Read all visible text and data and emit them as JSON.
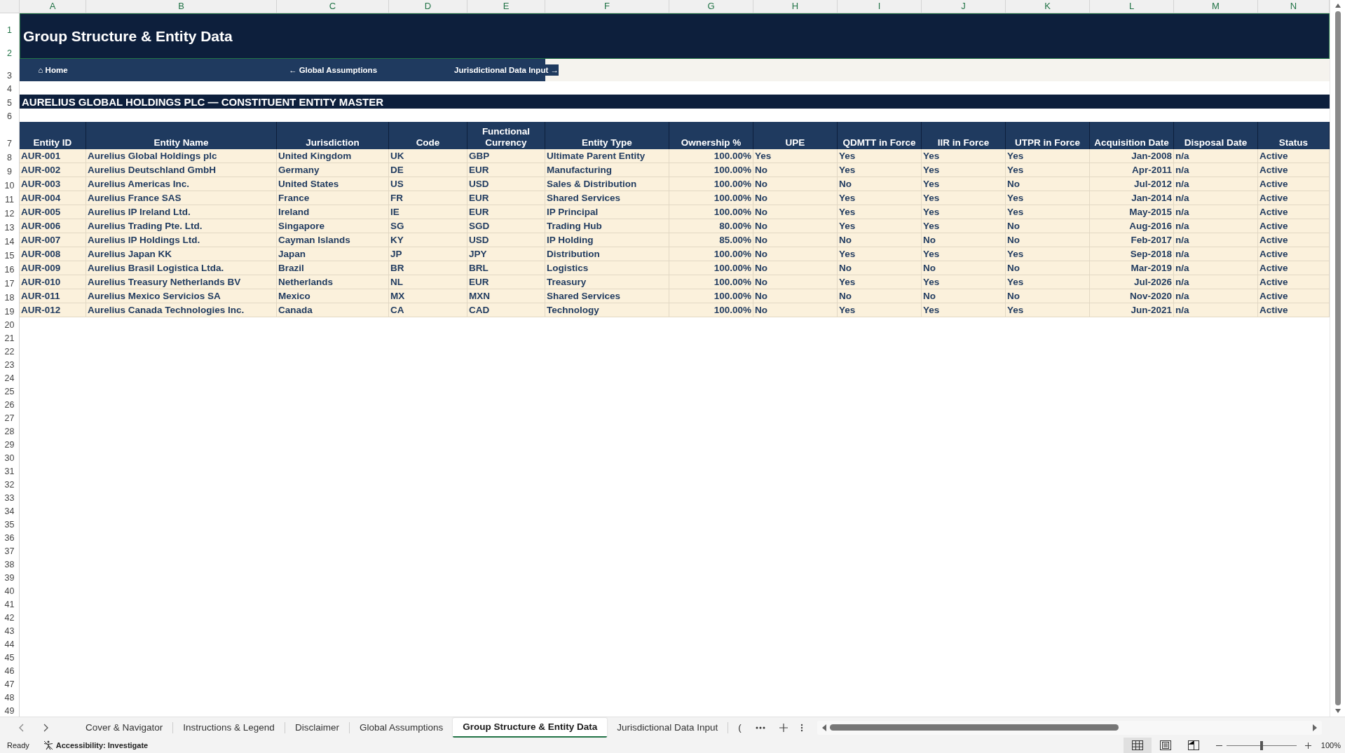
{
  "title": "Group Structure & Entity Data",
  "column_letters": [
    "A",
    "B",
    "C",
    "D",
    "E",
    "F",
    "G",
    "H",
    "I",
    "J",
    "K",
    "L",
    "M",
    "N"
  ],
  "row_numbers": [
    "1",
    "2",
    "3",
    "4",
    "5",
    "6",
    "7",
    "8",
    "9",
    "10",
    "11",
    "12",
    "13",
    "14",
    "15",
    "16",
    "17",
    "18",
    "19",
    "20",
    "21",
    "22",
    "23",
    "24",
    "25",
    "26",
    "27",
    "28",
    "29",
    "30",
    "31",
    "32",
    "33",
    "34",
    "35",
    "36",
    "37",
    "38",
    "39",
    "40",
    "41",
    "42",
    "43",
    "44",
    "45",
    "46",
    "47",
    "48",
    "49"
  ],
  "nav_links": [
    {
      "label": "⌂ Home"
    },
    {
      "label": "← Global Assumptions"
    },
    {
      "label": "Jurisdictional Data Input →"
    }
  ],
  "section_title": "AURELIUS GLOBAL HOLDINGS PLC — CONSTITUENT ENTITY MASTER",
  "table": {
    "columns": [
      "Entity ID",
      "Entity Name",
      "Jurisdiction",
      "Code",
      "Functional Currency",
      "Entity Type",
      "Ownership %",
      "UPE",
      "QDMTT in Force",
      "IIR in Force",
      "UTPR in Force",
      "Acquisition Date",
      "Disposal Date",
      "Status"
    ],
    "rows": [
      [
        "AUR-001",
        "Aurelius Global Holdings plc",
        "United Kingdom",
        "UK",
        "GBP",
        "Ultimate Parent Entity",
        "100.00%",
        "Yes",
        "Yes",
        "Yes",
        "Yes",
        "Jan-2008",
        "n/a",
        "Active"
      ],
      [
        "AUR-002",
        "Aurelius Deutschland GmbH",
        "Germany",
        "DE",
        "EUR",
        "Manufacturing",
        "100.00%",
        "No",
        "Yes",
        "Yes",
        "Yes",
        "Apr-2011",
        "n/a",
        "Active"
      ],
      [
        "AUR-003",
        "Aurelius Americas Inc.",
        "United States",
        "US",
        "USD",
        "Sales & Distribution",
        "100.00%",
        "No",
        "No",
        "Yes",
        "No",
        "Jul-2012",
        "n/a",
        "Active"
      ],
      [
        "AUR-004",
        "Aurelius France SAS",
        "France",
        "FR",
        "EUR",
        "Shared Services",
        "100.00%",
        "No",
        "Yes",
        "Yes",
        "Yes",
        "Jan-2014",
        "n/a",
        "Active"
      ],
      [
        "AUR-005",
        "Aurelius IP Ireland Ltd.",
        "Ireland",
        "IE",
        "EUR",
        "IP Principal",
        "100.00%",
        "No",
        "Yes",
        "Yes",
        "Yes",
        "May-2015",
        "n/a",
        "Active"
      ],
      [
        "AUR-006",
        "Aurelius Trading Pte. Ltd.",
        "Singapore",
        "SG",
        "SGD",
        "Trading Hub",
        "80.00%",
        "No",
        "Yes",
        "Yes",
        "No",
        "Aug-2016",
        "n/a",
        "Active"
      ],
      [
        "AUR-007",
        "Aurelius IP Holdings Ltd.",
        "Cayman Islands",
        "KY",
        "USD",
        "IP Holding",
        "85.00%",
        "No",
        "No",
        "No",
        "No",
        "Feb-2017",
        "n/a",
        "Active"
      ],
      [
        "AUR-008",
        "Aurelius Japan KK",
        "Japan",
        "JP",
        "JPY",
        "Distribution",
        "100.00%",
        "No",
        "Yes",
        "Yes",
        "Yes",
        "Sep-2018",
        "n/a",
        "Active"
      ],
      [
        "AUR-009",
        "Aurelius Brasil Logistica Ltda.",
        "Brazil",
        "BR",
        "BRL",
        "Logistics",
        "100.00%",
        "No",
        "No",
        "No",
        "No",
        "Mar-2019",
        "n/a",
        "Active"
      ],
      [
        "AUR-010",
        "Aurelius Treasury Netherlands BV",
        "Netherlands",
        "NL",
        "EUR",
        "Treasury",
        "100.00%",
        "No",
        "Yes",
        "Yes",
        "Yes",
        "Jul-2026",
        "n/a",
        "Active"
      ],
      [
        "AUR-011",
        "Aurelius Mexico Servicios SA",
        "Mexico",
        "MX",
        "MXN",
        "Shared Services",
        "100.00%",
        "No",
        "No",
        "No",
        "No",
        "Nov-2020",
        "n/a",
        "Active"
      ],
      [
        "AUR-012",
        "Aurelius Canada Technologies Inc.",
        "Canada",
        "CA",
        "CAD",
        "Technology",
        "100.00%",
        "No",
        "Yes",
        "Yes",
        "Yes",
        "Jun-2021",
        "n/a",
        "Active"
      ]
    ]
  },
  "sheet_tabs": [
    {
      "label": "Cover & Navigator",
      "selected": false
    },
    {
      "label": "Instructions & Legend",
      "selected": false
    },
    {
      "label": "Disclaimer",
      "selected": false
    },
    {
      "label": "Global Assumptions",
      "selected": false
    },
    {
      "label": "Group Structure & Entity Data",
      "selected": true
    },
    {
      "label": "Jurisdictional Data Input",
      "selected": false
    },
    {
      "label": "(",
      "selected": false
    }
  ],
  "status_bar": {
    "ready": "Ready",
    "accessibility": "Accessibility: Investigate",
    "views": [
      {
        "kind": "normal",
        "selected": true
      },
      {
        "kind": "page_layout",
        "selected": false
      },
      {
        "kind": "page_break",
        "selected": false
      }
    ],
    "zoom": {
      "level": 0.5,
      "reading": "100%"
    }
  }
}
